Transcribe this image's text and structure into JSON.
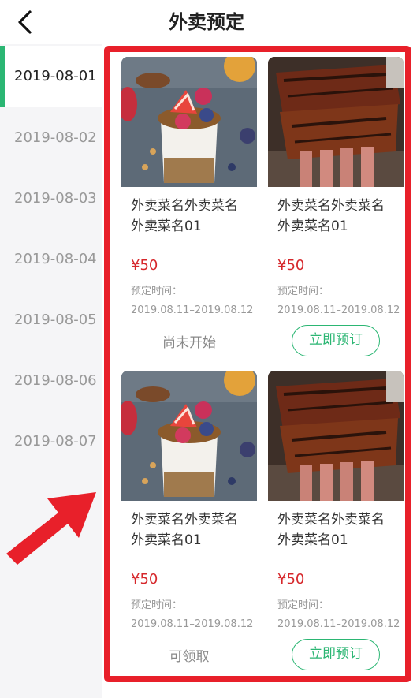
{
  "header": {
    "title": "外卖预定",
    "back_icon": "chevron-left-icon"
  },
  "sidebar": {
    "active_index": 0,
    "accent_color": "#2bb673",
    "dates": [
      "2019-08-01",
      "2019-08-02",
      "2019-08-03",
      "2019-08-04",
      "2019-08-05",
      "2019-08-06",
      "2019-08-07"
    ]
  },
  "cards": [
    {
      "image": "parfait-photo",
      "name": "外卖菜名外卖菜名外卖菜名01",
      "price": "¥50",
      "time_label": "预定时间：",
      "time_range": "2019.08.11–2019.08.12",
      "action_type": "status",
      "action_text": "尚未开始"
    },
    {
      "image": "ribs-photo",
      "name": "外卖菜名外卖菜名外卖菜名01",
      "price": "¥50",
      "time_label": "预定时间：",
      "time_range": "2019.08.11–2019.08.12",
      "action_type": "button",
      "action_text": "立即预订"
    },
    {
      "image": "parfait-photo",
      "name": "外卖菜名外卖菜名外卖菜名01",
      "price": "¥50",
      "time_label": "预定时间：",
      "time_range": "2019.08.11–2019.08.12",
      "action_type": "status",
      "action_text": "可领取"
    },
    {
      "image": "ribs-photo",
      "name": "外卖菜名外卖菜名外卖菜名01",
      "price": "¥50",
      "time_label": "预定时间：",
      "time_range": "2019.08.11–2019.08.12",
      "action_type": "button",
      "action_text": "立即预订"
    }
  ],
  "colors": {
    "price": "#d6272b",
    "button": "#2bb673",
    "annotation": "#e8202a"
  }
}
